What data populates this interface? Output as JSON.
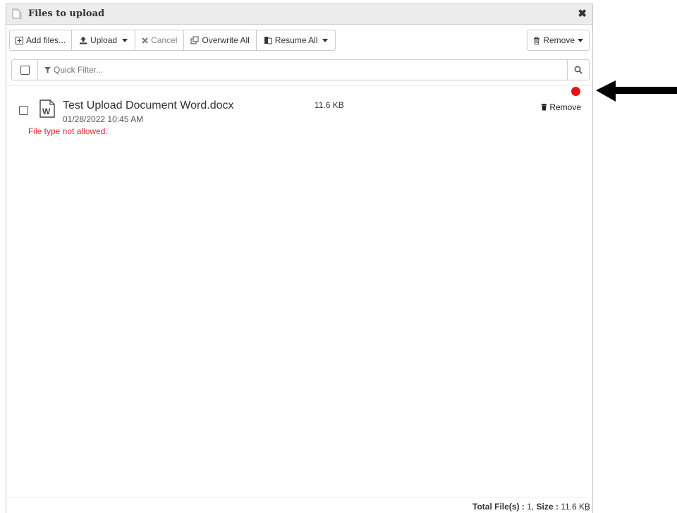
{
  "window": {
    "title": "Files to upload",
    "close_glyph": "✖"
  },
  "toolbar": {
    "add_files": "Add files...",
    "upload": "Upload",
    "cancel": "Cancel",
    "overwrite_all": "Overwrite All",
    "resume_all": "Resume All",
    "remove": "Remove"
  },
  "filter": {
    "placeholder": "Quick Filter..."
  },
  "files": [
    {
      "name": "Test Upload Document Word.docx",
      "date": "01/28/2022 10:45 AM",
      "error": "File type not allowed.",
      "size": "11.6 KB",
      "remove_label": "Remove",
      "status_color": "#ee1111"
    }
  ],
  "footer": {
    "files_label": "Total File(s) :",
    "files_count": "1",
    "size_label": "Size :",
    "size_value": "11.6 KB"
  },
  "colors": {
    "error": "#e4262d",
    "status_dot": "#ee1111",
    "titlebar_bg": "#ececec"
  },
  "icons": [
    "file-icon",
    "close-icon",
    "plus-square-icon",
    "upload-icon",
    "cancel-icon",
    "overwrite-icon",
    "resume-icon",
    "trash-icon",
    "filter-icon",
    "search-icon",
    "word-doc-icon",
    "resize-grip-icon",
    "arrow-left-icon"
  ]
}
